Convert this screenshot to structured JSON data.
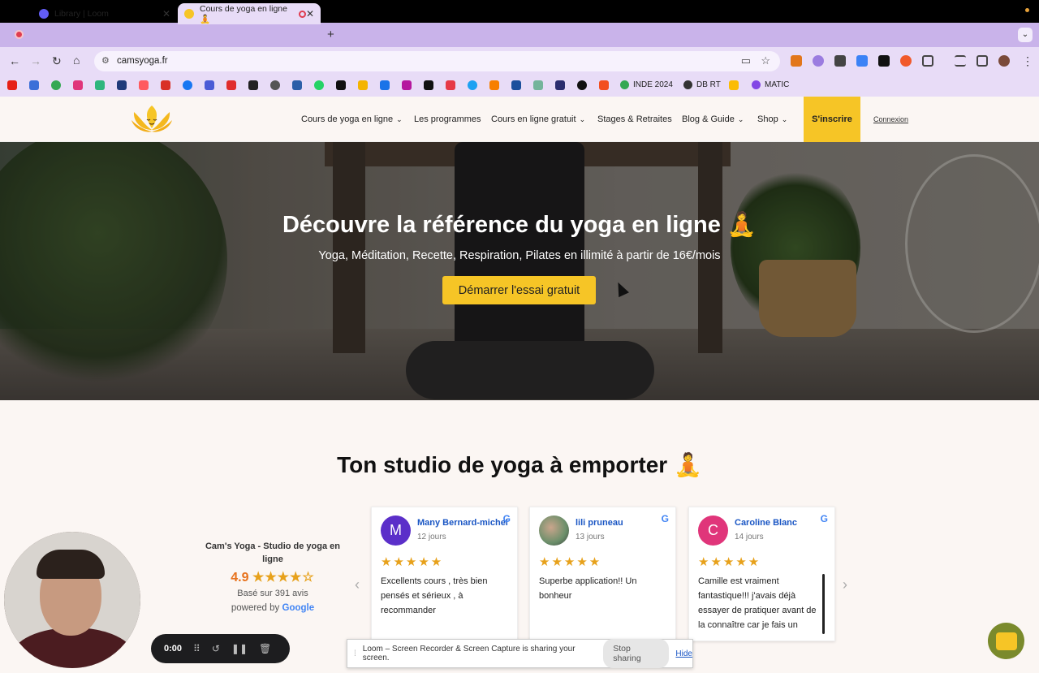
{
  "browser": {
    "tabs": [
      {
        "title": "Library | Loom",
        "active": false
      },
      {
        "title": "Cours de yoga en ligne 🧘",
        "active": true
      }
    ],
    "url": "camsyoga.fr",
    "bookmarks": {
      "inde": "INDE 2024",
      "dbrt": "DB RT",
      "matic": "MATIC"
    }
  },
  "site": {
    "nav": [
      {
        "label": "Cours de yoga en ligne",
        "dropdown": true
      },
      {
        "label": "Les programmes",
        "dropdown": false
      },
      {
        "label": "Cours en ligne gratuit",
        "dropdown": true
      },
      {
        "label": "Stages & Retraites",
        "dropdown": false
      },
      {
        "label": "Blog & Guide",
        "dropdown": true
      },
      {
        "label": "Shop",
        "dropdown": true
      }
    ],
    "signup": "S'inscrire",
    "login": "Connexion",
    "hero": {
      "title": "Découvre la référence du yoga en ligne 🧘",
      "subtitle": "Yoga, Méditation, Recette, Respiration, Pilates en illimité à partir de 16€/mois",
      "cta": "Démarrer l'essai gratuit"
    },
    "section_title": "Ton studio de yoga à emporter 🧘",
    "reviews_summary": {
      "name": "Cam's Yoga - Studio de yoga en ligne",
      "rating": "4.9",
      "stars": "★★★★☆",
      "based_on": "Basé sur 391 avis",
      "powered_by": "powered by",
      "google": "Google"
    },
    "reviews": [
      {
        "initial": "M",
        "name": "Many Bernard-michel",
        "date": "12 jours",
        "stars": "★★★★★",
        "text": "Excellents cours , très bien pensés et sérieux , à recommander",
        "color": "#5b2fc9"
      },
      {
        "initial": "",
        "name": "lili pruneau",
        "date": "13 jours",
        "stars": "★★★★★",
        "text": "Superbe application!! Un bonheur",
        "color": "#6b8f6a"
      },
      {
        "initial": "C",
        "name": "Caroline Blanc",
        "date": "14 jours",
        "stars": "★★★★★",
        "text": "Camille est vraiment fantastique!!! j'avais déjà essayer de pratiquer avant de la connaître car je fais un",
        "color": "#e0357a"
      }
    ]
  },
  "loom": {
    "timer": "0:00",
    "share_message": "Loom – Screen Recorder & Screen Capture is sharing your screen.",
    "stop_label": "Stop sharing",
    "hide_label": "Hide"
  }
}
